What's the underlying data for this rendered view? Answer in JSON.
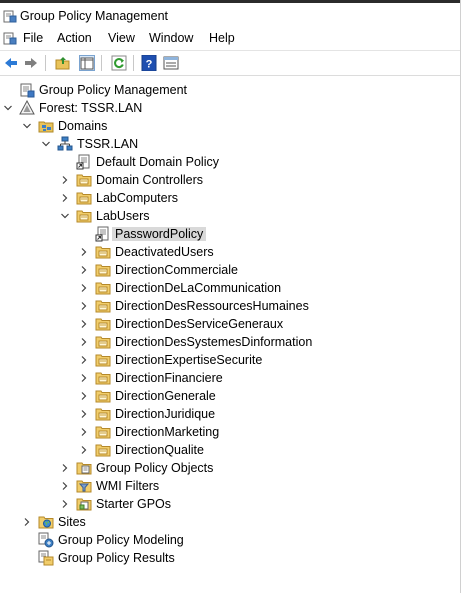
{
  "window": {
    "title": "Group Policy Management"
  },
  "menu": [
    "File",
    "Action",
    "View",
    "Window",
    "Help"
  ],
  "toolbar": [
    "back",
    "forward",
    "up-folder",
    "show-hide-tree",
    "refresh",
    "help",
    "properties"
  ],
  "tree": [
    {
      "label": "Group Policy Management",
      "depth": 0,
      "toggle": "none",
      "icon": "gpm"
    },
    {
      "label": "Forest: TSSR.LAN",
      "depth": 0,
      "toggle": "expanded",
      "icon": "forest"
    },
    {
      "label": "Domains",
      "depth": 1,
      "toggle": "expanded",
      "icon": "domains"
    },
    {
      "label": "TSSR.LAN",
      "depth": 2,
      "toggle": "expanded",
      "icon": "domain"
    },
    {
      "label": "Default Domain Policy",
      "depth": 3,
      "toggle": "none",
      "icon": "gpo-link"
    },
    {
      "label": "Domain Controllers",
      "depth": 3,
      "toggle": "collapsed",
      "icon": "ou"
    },
    {
      "label": "LabComputers",
      "depth": 3,
      "toggle": "collapsed",
      "icon": "ou"
    },
    {
      "label": "LabUsers",
      "depth": 3,
      "toggle": "expanded",
      "icon": "ou"
    },
    {
      "label": "PasswordPolicy",
      "depth": 4,
      "toggle": "none",
      "icon": "gpo-link",
      "selected": true
    },
    {
      "label": "DeactivatedUsers",
      "depth": 4,
      "toggle": "collapsed",
      "icon": "ou"
    },
    {
      "label": "DirectionCommerciale",
      "depth": 4,
      "toggle": "collapsed",
      "icon": "ou"
    },
    {
      "label": "DirectionDeLaCommunication",
      "depth": 4,
      "toggle": "collapsed",
      "icon": "ou"
    },
    {
      "label": "DirectionDesRessourcesHumaines",
      "depth": 4,
      "toggle": "collapsed",
      "icon": "ou"
    },
    {
      "label": "DirectionDesServiceGeneraux",
      "depth": 4,
      "toggle": "collapsed",
      "icon": "ou"
    },
    {
      "label": "DirectionDesSystemesDinformation",
      "depth": 4,
      "toggle": "collapsed",
      "icon": "ou"
    },
    {
      "label": "DirectionExpertiseSecurite",
      "depth": 4,
      "toggle": "collapsed",
      "icon": "ou"
    },
    {
      "label": "DirectionFinanciere",
      "depth": 4,
      "toggle": "collapsed",
      "icon": "ou"
    },
    {
      "label": "DirectionGenerale",
      "depth": 4,
      "toggle": "collapsed",
      "icon": "ou"
    },
    {
      "label": "DirectionJuridique",
      "depth": 4,
      "toggle": "collapsed",
      "icon": "ou"
    },
    {
      "label": "DirectionMarketing",
      "depth": 4,
      "toggle": "collapsed",
      "icon": "ou"
    },
    {
      "label": "DirectionQualite",
      "depth": 4,
      "toggle": "collapsed",
      "icon": "ou"
    },
    {
      "label": "Group Policy Objects",
      "depth": 3,
      "toggle": "collapsed",
      "icon": "gpo-folder"
    },
    {
      "label": "WMI Filters",
      "depth": 3,
      "toggle": "collapsed",
      "icon": "wmi"
    },
    {
      "label": "Starter GPOs",
      "depth": 3,
      "toggle": "collapsed",
      "icon": "starter"
    },
    {
      "label": "Sites",
      "depth": 1,
      "toggle": "collapsed",
      "icon": "sites"
    },
    {
      "label": "Group Policy Modeling",
      "depth": 1,
      "toggle": "none",
      "icon": "modeling"
    },
    {
      "label": "Group Policy Results",
      "depth": 1,
      "toggle": "none",
      "icon": "results"
    }
  ]
}
